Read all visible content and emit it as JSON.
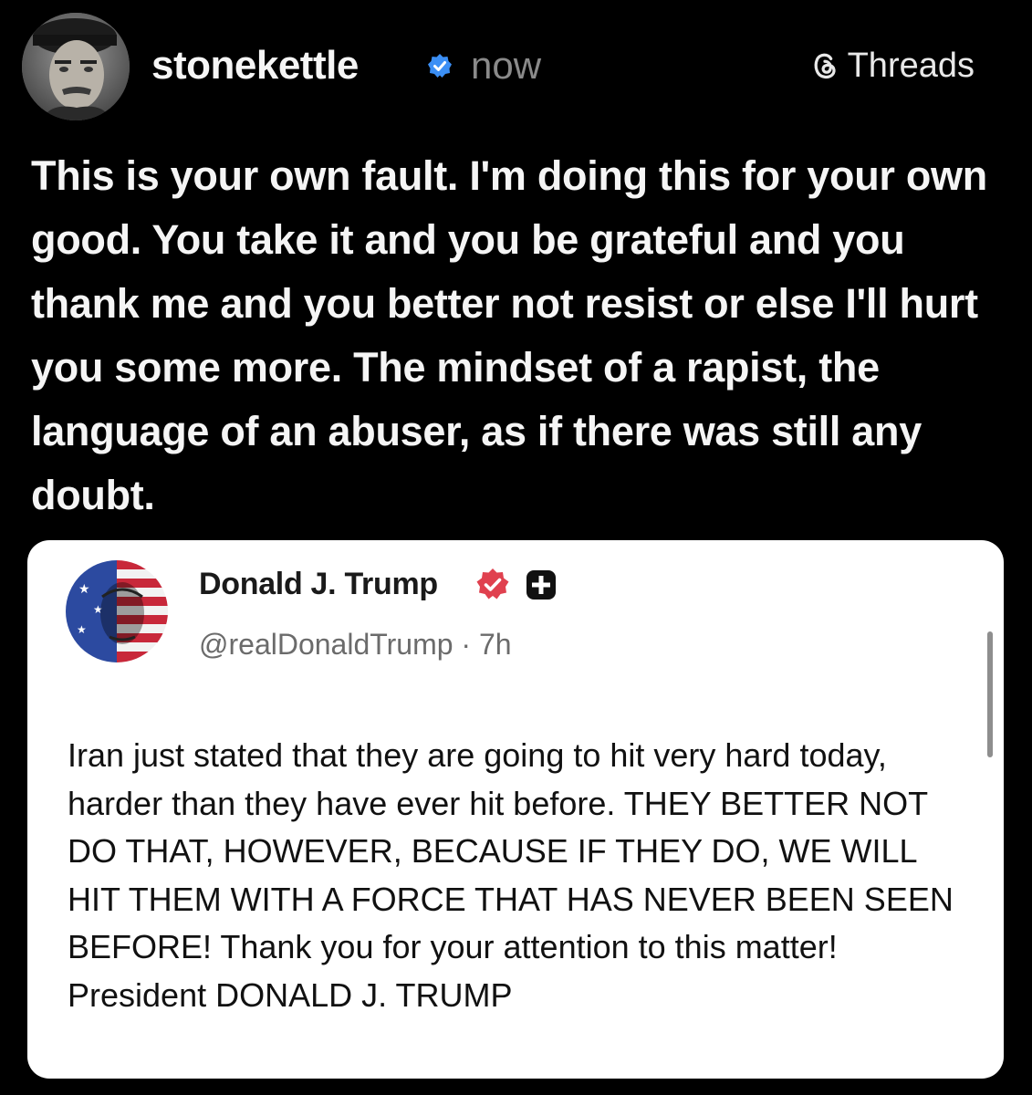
{
  "post": {
    "author": {
      "username": "stonekettle",
      "verified_icon": "verified-badge-icon",
      "timestamp": "now"
    },
    "platform": {
      "label": "Threads",
      "icon": "threads-logo-icon"
    },
    "text": "This is your own fault. I'm doing this for your own good. You take it and you be grateful and you thank me and you better not resist or else I'll hurt you some more. The mindset of a rapist, the language of an abuser, as if there was still any doubt."
  },
  "quoted_post": {
    "author": {
      "name": "Donald J. Trump",
      "verified_icon": "verified-badge-icon",
      "plus_icon": "plus-badge-icon",
      "handle": "@realDonaldTrump · 7h"
    },
    "text": "Iran just stated that they are going to hit very hard today, harder than they have ever hit before. THEY BETTER NOT DO THAT, HOWEVER, BECAUSE IF THEY DO, WE WILL HIT THEM WITH A FORCE THAT HAS NEVER BEEN SEEN BEFORE! Thank you for your attention to this matter! President DONALD J. TRUMP"
  },
  "colors": {
    "background": "#000000",
    "primary_text": "#f5f5f5",
    "secondary_text": "#8a8a8a",
    "verified_blue": "#0095f6",
    "card_background": "#ffffff",
    "truth_badge": "#e0414f"
  }
}
